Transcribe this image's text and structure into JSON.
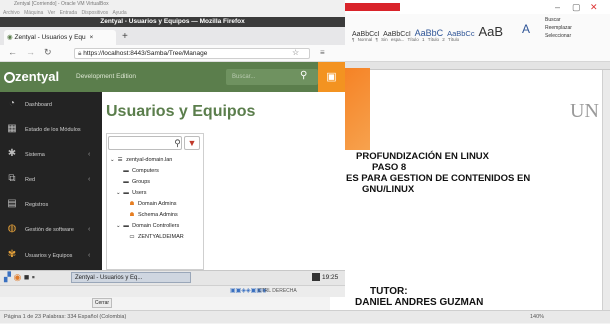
{
  "vm_window": {
    "title": "Zentyal [Corriendo] - Oracle VM VirtualBox",
    "menu": [
      "Archivo",
      "Máquina",
      "Ver",
      "Entrada",
      "Dispositivos",
      "Ayuda"
    ],
    "status_right": "CTRL DERECHA"
  },
  "firefox": {
    "window_title": "Zentyal - Usuarios y Equipos — Mozilla Firefox",
    "tab_label": "Zentyal - Usuarios y Equ",
    "url": "https://localhost:8443/Samba/Tree/Manage"
  },
  "zentyal": {
    "brand": "zentyal",
    "edition": "Development Edition",
    "search_placeholder": "Buscar...",
    "page_title": "Usuarios y Equipos",
    "colors": {
      "header": "#5b7e4c",
      "sidebar": "#232323",
      "accent": "#f39321",
      "ou": "#e67e22"
    },
    "sidebar_items": [
      {
        "label": "Dashboard",
        "icon": "dashboard-icon",
        "chevron": ""
      },
      {
        "label": "Estado de los Módulos",
        "icon": "modules-icon",
        "chevron": ""
      },
      {
        "label": "Sistema",
        "icon": "gear-icon",
        "chevron": "‹"
      },
      {
        "label": "Red",
        "icon": "network-icon",
        "chevron": "‹"
      },
      {
        "label": "Registros",
        "icon": "logs-icon",
        "chevron": ""
      },
      {
        "label": "Gestión de software",
        "icon": "software-icon",
        "chevron": "‹"
      },
      {
        "label": "Usuarios y Equipos",
        "icon": "users-icon",
        "chevron": "‹"
      }
    ],
    "tree": {
      "domain": "zentyal-domain.lan",
      "computers": "Computers",
      "groups": "Groups",
      "users": "Users",
      "domain_admins": "Domain Admins",
      "schema_admins": "Schema Admins",
      "domain_controllers": "Domain Controllers",
      "dc_host": "ZENTYALDEIMAR"
    }
  },
  "guest_taskbar": {
    "app_label": "Zentyal - Usuarios y Eq...",
    "time": "19:25"
  },
  "vm_dialog": {
    "close_button": "Cerrar"
  },
  "word": {
    "ribbon_styles": [
      "AaBbCcI",
      "AaBbCcI",
      "AaBbC",
      "AaBbCc",
      "AaB"
    ],
    "style_names": [
      "¶ Normal",
      "¶ Sin espa...",
      "Título 1",
      "Título 2",
      "Título"
    ],
    "ribbon_right": [
      "Buscar",
      "Reemplazar",
      "Seleccionar"
    ],
    "doc_lines": [
      "PROFUNDIZACIÓN EN LINUX",
      "PASO 8",
      "ES PARA GESTION DE CONTENIDOS EN",
      "GNU/LINUX",
      "TUTOR:",
      "DANIEL ANDRES GUZMAN"
    ],
    "status": "Página 1 de 23   Palabras: 334   Español (Colombia)",
    "zoom": "140%"
  }
}
